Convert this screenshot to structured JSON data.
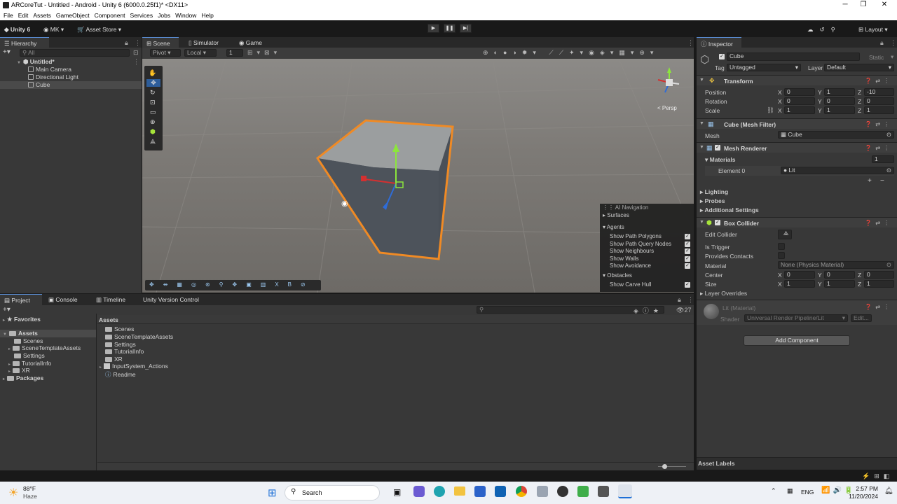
{
  "window": {
    "title": "ARCoreTut - Untitled - Android - Unity 6 (6000.0.25f1)* <DX11>"
  },
  "menu": [
    "File",
    "Edit",
    "Assets",
    "GameObject",
    "Component",
    "Services",
    "Jobs",
    "Window",
    "Help"
  ],
  "toolbar": {
    "unity": "Unity 6",
    "account": "MK",
    "asset_store": "Asset Store",
    "layout": "Layout"
  },
  "hierarchy": {
    "tab": "Hierarchy",
    "search_placeholder": "All",
    "scene": "Untitled*",
    "items": [
      "Main Camera",
      "Directional Light",
      "Cube"
    ]
  },
  "scene_tabs": [
    "Scene",
    "Simulator",
    "Game"
  ],
  "scene_toolbar": {
    "pivot": "Pivot",
    "local": "Local",
    "grid_value": "1"
  },
  "gizmo": {
    "persp": "< Persp"
  },
  "ai_nav": {
    "title": "AI Navigation",
    "surfaces": "Surfaces",
    "agents": "Agents",
    "agent_options": [
      "Show Path Polygons",
      "Show Path Query Nodes",
      "Show Neighbours",
      "Show Walls",
      "Show Avoidance"
    ],
    "obstacles": "Obstacles",
    "obstacle_options": [
      "Show Carve Hull"
    ]
  },
  "inspector": {
    "tab": "Inspector",
    "object_name": "Cube",
    "static": "Static",
    "tag_label": "Tag",
    "tag_value": "Untagged",
    "layer_label": "Layer",
    "layer_value": "Default",
    "transform": {
      "title": "Transform",
      "position": {
        "label": "Position",
        "x": "0",
        "y": "1",
        "z": "-10"
      },
      "rotation": {
        "label": "Rotation",
        "x": "0",
        "y": "0",
        "z": "0"
      },
      "scale": {
        "label": "Scale",
        "x": "1",
        "y": "1",
        "z": "1"
      }
    },
    "mesh_filter": {
      "title": "Cube (Mesh Filter)",
      "mesh_label": "Mesh",
      "mesh_value": "Cube"
    },
    "mesh_renderer": {
      "title": "Mesh Renderer",
      "materials": "Materials",
      "count": "1",
      "element": "Element 0",
      "element_value": "Lit"
    },
    "sections": [
      "Lighting",
      "Probes",
      "Additional Settings"
    ],
    "box_collider": {
      "title": "Box Collider",
      "edit_collider": "Edit Collider",
      "is_trigger": "Is Trigger",
      "provides_contacts": "Provides Contacts",
      "material_label": "Material",
      "material_value": "None (Physics Material)",
      "center": {
        "label": "Center",
        "x": "0",
        "y": "0",
        "z": "0"
      },
      "size": {
        "label": "Size",
        "x": "1",
        "y": "1",
        "z": "1"
      },
      "layer_overrides": "Layer Overrides"
    },
    "material": {
      "name": "Lit (Material)",
      "shader_label": "Shader",
      "shader_value": "Universal Render Pipeline/Lit",
      "edit": "Edit..."
    },
    "add_component": "Add Component",
    "asset_labels": "Asset Labels"
  },
  "bottom_tabs": [
    "Project",
    "Console",
    "Timeline",
    "Unity Version Control"
  ],
  "project": {
    "favorites": "Favorites",
    "assets": "Assets",
    "tree": [
      "Scenes",
      "SceneTemplateAssets",
      "Settings",
      "TutorialInfo",
      "XR"
    ],
    "packages": "Packages",
    "breadcrumb": "Assets",
    "files": [
      "Scenes",
      "SceneTemplateAssets",
      "Settings",
      "TutorialInfo",
      "XR",
      "InputSystem_Actions",
      "Readme"
    ],
    "count": "27"
  },
  "taskbar": {
    "weather_temp": "88°F",
    "weather_desc": "Haze",
    "search": "Search",
    "lang": "ENG",
    "time": "2:57 PM",
    "date": "11/20/2024"
  },
  "colors": {
    "accent": "#5a8ed6",
    "selection": "#f08a24",
    "panel": "#383838"
  }
}
